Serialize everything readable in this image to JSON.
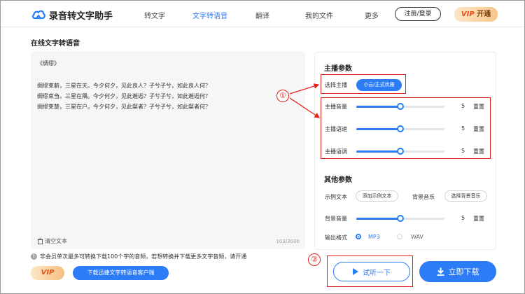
{
  "app": {
    "name": "录音转文字助手"
  },
  "nav": {
    "items": [
      {
        "label": "转文字",
        "active": false
      },
      {
        "label": "文字转语音",
        "active": true
      },
      {
        "label": "翻译",
        "active": false
      },
      {
        "label": "我的文件",
        "active": false
      },
      {
        "label": "更多",
        "active": false
      }
    ],
    "login_label": "注册/登录",
    "vip_label_v": "VIP",
    "vip_label_text": "开通"
  },
  "page": {
    "title": "在线文字转语音"
  },
  "editor": {
    "lines": [
      "《绸缪》",
      "绸缪束薪，三星在天。今夕何夕，见此良人？子兮子兮，如此良人何？",
      "绸缪束刍，三星在隅。今夕何夕，见此邂逅？子兮子兮，如此邂逅何？",
      "绸缪束楚，三星在户。今夕何夕，见此粲者？子兮子兮，如此粲者何？"
    ],
    "clear_label": "清空文本",
    "char_count": "103/3000"
  },
  "notice": "非会员单次最多可转换下载100个字的音频，若想转换并下载更多文字音频，请开通",
  "footer_left": {
    "vip_label": "VIP",
    "client_download_label": "下载迅捷文字转语音客户端"
  },
  "settings": {
    "anchor_section_title": "主播参数",
    "anchor_label": "选择主播",
    "anchor_value": "小云/正式优雅",
    "sliders": [
      {
        "label": "主播音量",
        "value": "5",
        "fraction": 0.5,
        "reset": "重置"
      },
      {
        "label": "主播语速",
        "value": "5",
        "fraction": 0.5,
        "reset": "重置"
      },
      {
        "label": "主播语调",
        "value": "5",
        "fraction": 0.5,
        "reset": "重置"
      }
    ],
    "other_section_title": "其他参数",
    "sample_text_label": "示例文本",
    "sample_text_button": "添加示例文本",
    "bg_music_label": "背景音乐",
    "bg_music_button": "选择背景音乐",
    "bg_volume": {
      "label": "背景音量",
      "value": "5",
      "fraction": 0.5,
      "reset": "重置"
    },
    "output_format_label": "输出格式",
    "formats": [
      {
        "label": "MP3",
        "selected": true
      },
      {
        "label": "WAV",
        "selected": false
      }
    ]
  },
  "actions": {
    "listen_label": "试听一下",
    "download_label": "立即下载"
  },
  "annotations": {
    "one": "①",
    "two": "②"
  },
  "colors": {
    "accent": "#2b7cf6",
    "annotation": "#e2231a",
    "vip_gold": "#f7c68a"
  }
}
